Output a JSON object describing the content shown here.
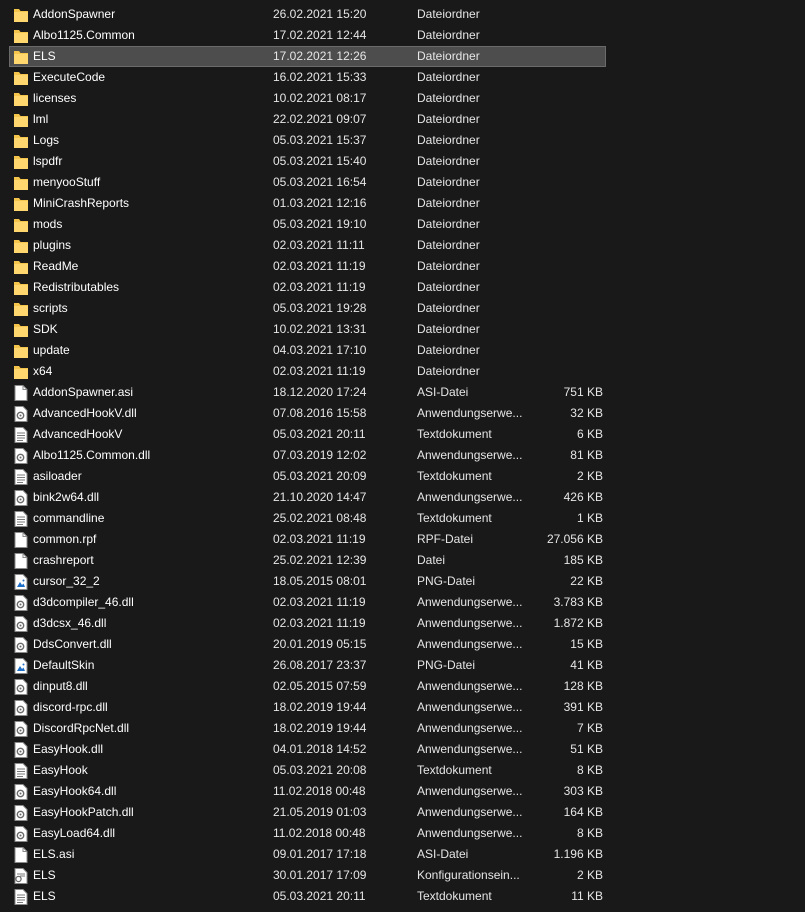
{
  "colors": {
    "background": "#191919",
    "selection": "#4d4d4d",
    "folder_icon": "#f4c54a",
    "text": "#ffffff"
  },
  "files": [
    {
      "name": "AddonSpawner",
      "date": "26.02.2021 15:20",
      "type": "Dateiordner",
      "size": "",
      "icon": "folder-icon"
    },
    {
      "name": "Albo1125.Common",
      "date": "17.02.2021 12:44",
      "type": "Dateiordner",
      "size": "",
      "icon": "folder-icon"
    },
    {
      "name": "ELS",
      "date": "17.02.2021 12:26",
      "type": "Dateiordner",
      "size": "",
      "icon": "folder-icon",
      "selected": true
    },
    {
      "name": "ExecuteCode",
      "date": "16.02.2021 15:33",
      "type": "Dateiordner",
      "size": "",
      "icon": "folder-icon"
    },
    {
      "name": "licenses",
      "date": "10.02.2021 08:17",
      "type": "Dateiordner",
      "size": "",
      "icon": "folder-icon"
    },
    {
      "name": "lml",
      "date": "22.02.2021 09:07",
      "type": "Dateiordner",
      "size": "",
      "icon": "folder-icon"
    },
    {
      "name": "Logs",
      "date": "05.03.2021 15:37",
      "type": "Dateiordner",
      "size": "",
      "icon": "folder-icon"
    },
    {
      "name": "lspdfr",
      "date": "05.03.2021 15:40",
      "type": "Dateiordner",
      "size": "",
      "icon": "folder-icon"
    },
    {
      "name": "menyooStuff",
      "date": "05.03.2021 16:54",
      "type": "Dateiordner",
      "size": "",
      "icon": "folder-icon"
    },
    {
      "name": "MiniCrashReports",
      "date": "01.03.2021 12:16",
      "type": "Dateiordner",
      "size": "",
      "icon": "folder-icon"
    },
    {
      "name": "mods",
      "date": "05.03.2021 19:10",
      "type": "Dateiordner",
      "size": "",
      "icon": "folder-icon"
    },
    {
      "name": "plugins",
      "date": "02.03.2021 11:11",
      "type": "Dateiordner",
      "size": "",
      "icon": "folder-icon"
    },
    {
      "name": "ReadMe",
      "date": "02.03.2021 11:19",
      "type": "Dateiordner",
      "size": "",
      "icon": "folder-icon"
    },
    {
      "name": "Redistributables",
      "date": "02.03.2021 11:19",
      "type": "Dateiordner",
      "size": "",
      "icon": "folder-icon"
    },
    {
      "name": "scripts",
      "date": "05.03.2021 19:28",
      "type": "Dateiordner",
      "size": "",
      "icon": "folder-icon"
    },
    {
      "name": "SDK",
      "date": "10.02.2021 13:31",
      "type": "Dateiordner",
      "size": "",
      "icon": "folder-icon"
    },
    {
      "name": "update",
      "date": "04.03.2021 17:10",
      "type": "Dateiordner",
      "size": "",
      "icon": "folder-icon"
    },
    {
      "name": "x64",
      "date": "02.03.2021 11:19",
      "type": "Dateiordner",
      "size": "",
      "icon": "folder-icon"
    },
    {
      "name": "AddonSpawner.asi",
      "date": "18.12.2020 17:24",
      "type": "ASI-Datei",
      "size": "751 KB",
      "icon": "file-icon"
    },
    {
      "name": "AdvancedHookV.dll",
      "date": "07.08.2016 15:58",
      "type": "Anwendungserwe...",
      "size": "32 KB",
      "icon": "dll-icon"
    },
    {
      "name": "AdvancedHookV",
      "date": "05.03.2021 20:11",
      "type": "Textdokument",
      "size": "6 KB",
      "icon": "text-file-icon"
    },
    {
      "name": "Albo1125.Common.dll",
      "date": "07.03.2019 12:02",
      "type": "Anwendungserwe...",
      "size": "81 KB",
      "icon": "dll-icon"
    },
    {
      "name": "asiloader",
      "date": "05.03.2021 20:09",
      "type": "Textdokument",
      "size": "2 KB",
      "icon": "text-file-icon"
    },
    {
      "name": "bink2w64.dll",
      "date": "21.10.2020 14:47",
      "type": "Anwendungserwe...",
      "size": "426 KB",
      "icon": "dll-icon"
    },
    {
      "name": "commandline",
      "date": "25.02.2021 08:48",
      "type": "Textdokument",
      "size": "1 KB",
      "icon": "text-file-icon"
    },
    {
      "name": "common.rpf",
      "date": "02.03.2021 11:19",
      "type": "RPF-Datei",
      "size": "27.056 KB",
      "icon": "file-icon"
    },
    {
      "name": "crashreport",
      "date": "25.02.2021 12:39",
      "type": "Datei",
      "size": "185 KB",
      "icon": "file-icon"
    },
    {
      "name": "cursor_32_2",
      "date": "18.05.2015 08:01",
      "type": "PNG-Datei",
      "size": "22 KB",
      "icon": "image-file-icon"
    },
    {
      "name": "d3dcompiler_46.dll",
      "date": "02.03.2021 11:19",
      "type": "Anwendungserwe...",
      "size": "3.783 KB",
      "icon": "dll-icon"
    },
    {
      "name": "d3dcsx_46.dll",
      "date": "02.03.2021 11:19",
      "type": "Anwendungserwe...",
      "size": "1.872 KB",
      "icon": "dll-icon"
    },
    {
      "name": "DdsConvert.dll",
      "date": "20.01.2019 05:15",
      "type": "Anwendungserwe...",
      "size": "15 KB",
      "icon": "dll-icon"
    },
    {
      "name": "DefaultSkin",
      "date": "26.08.2017 23:37",
      "type": "PNG-Datei",
      "size": "41 KB",
      "icon": "image-file-icon"
    },
    {
      "name": "dinput8.dll",
      "date": "02.05.2015 07:59",
      "type": "Anwendungserwe...",
      "size": "128 KB",
      "icon": "dll-icon"
    },
    {
      "name": "discord-rpc.dll",
      "date": "18.02.2019 19:44",
      "type": "Anwendungserwe...",
      "size": "391 KB",
      "icon": "dll-icon"
    },
    {
      "name": "DiscordRpcNet.dll",
      "date": "18.02.2019 19:44",
      "type": "Anwendungserwe...",
      "size": "7 KB",
      "icon": "dll-icon"
    },
    {
      "name": "EasyHook.dll",
      "date": "04.01.2018 14:52",
      "type": "Anwendungserwe...",
      "size": "51 KB",
      "icon": "dll-icon"
    },
    {
      "name": "EasyHook",
      "date": "05.03.2021 20:08",
      "type": "Textdokument",
      "size": "8 KB",
      "icon": "text-file-icon"
    },
    {
      "name": "EasyHook64.dll",
      "date": "11.02.2018 00:48",
      "type": "Anwendungserwe...",
      "size": "303 KB",
      "icon": "dll-icon"
    },
    {
      "name": "EasyHookPatch.dll",
      "date": "21.05.2019 01:03",
      "type": "Anwendungserwe...",
      "size": "164 KB",
      "icon": "dll-icon"
    },
    {
      "name": "EasyLoad64.dll",
      "date": "11.02.2018 00:48",
      "type": "Anwendungserwe...",
      "size": "8 KB",
      "icon": "dll-icon"
    },
    {
      "name": "ELS.asi",
      "date": "09.01.2017 17:18",
      "type": "ASI-Datei",
      "size": "1.196 KB",
      "icon": "file-icon"
    },
    {
      "name": "ELS",
      "date": "30.01.2017 17:09",
      "type": "Konfigurationsein...",
      "size": "2 KB",
      "icon": "config-file-icon"
    },
    {
      "name": "ELS",
      "date": "05.03.2021 20:11",
      "type": "Textdokument",
      "size": "11 KB",
      "icon": "text-file-icon"
    }
  ]
}
